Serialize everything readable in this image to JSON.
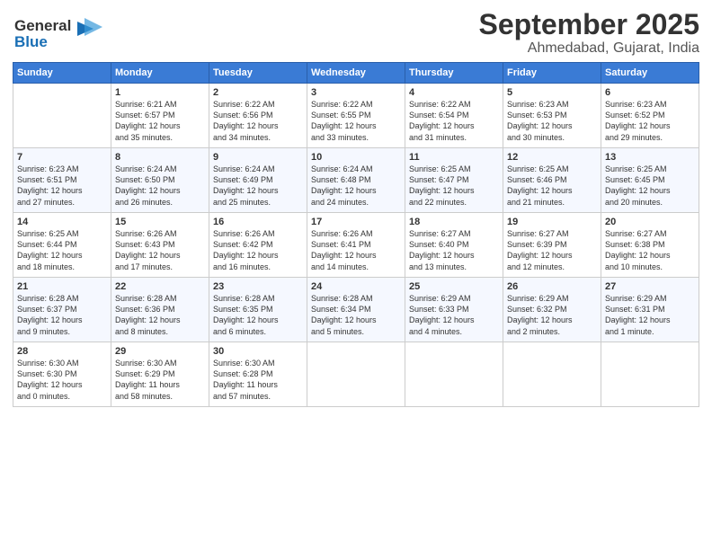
{
  "header": {
    "logo_line1": "General",
    "logo_line2": "Blue",
    "month": "September 2025",
    "location": "Ahmedabad, Gujarat, India"
  },
  "weekdays": [
    "Sunday",
    "Monday",
    "Tuesday",
    "Wednesday",
    "Thursday",
    "Friday",
    "Saturday"
  ],
  "weeks": [
    [
      {
        "day": "",
        "text": ""
      },
      {
        "day": "1",
        "text": "Sunrise: 6:21 AM\nSunset: 6:57 PM\nDaylight: 12 hours\nand 35 minutes."
      },
      {
        "day": "2",
        "text": "Sunrise: 6:22 AM\nSunset: 6:56 PM\nDaylight: 12 hours\nand 34 minutes."
      },
      {
        "day": "3",
        "text": "Sunrise: 6:22 AM\nSunset: 6:55 PM\nDaylight: 12 hours\nand 33 minutes."
      },
      {
        "day": "4",
        "text": "Sunrise: 6:22 AM\nSunset: 6:54 PM\nDaylight: 12 hours\nand 31 minutes."
      },
      {
        "day": "5",
        "text": "Sunrise: 6:23 AM\nSunset: 6:53 PM\nDaylight: 12 hours\nand 30 minutes."
      },
      {
        "day": "6",
        "text": "Sunrise: 6:23 AM\nSunset: 6:52 PM\nDaylight: 12 hours\nand 29 minutes."
      }
    ],
    [
      {
        "day": "7",
        "text": "Sunrise: 6:23 AM\nSunset: 6:51 PM\nDaylight: 12 hours\nand 27 minutes."
      },
      {
        "day": "8",
        "text": "Sunrise: 6:24 AM\nSunset: 6:50 PM\nDaylight: 12 hours\nand 26 minutes."
      },
      {
        "day": "9",
        "text": "Sunrise: 6:24 AM\nSunset: 6:49 PM\nDaylight: 12 hours\nand 25 minutes."
      },
      {
        "day": "10",
        "text": "Sunrise: 6:24 AM\nSunset: 6:48 PM\nDaylight: 12 hours\nand 24 minutes."
      },
      {
        "day": "11",
        "text": "Sunrise: 6:25 AM\nSunset: 6:47 PM\nDaylight: 12 hours\nand 22 minutes."
      },
      {
        "day": "12",
        "text": "Sunrise: 6:25 AM\nSunset: 6:46 PM\nDaylight: 12 hours\nand 21 minutes."
      },
      {
        "day": "13",
        "text": "Sunrise: 6:25 AM\nSunset: 6:45 PM\nDaylight: 12 hours\nand 20 minutes."
      }
    ],
    [
      {
        "day": "14",
        "text": "Sunrise: 6:25 AM\nSunset: 6:44 PM\nDaylight: 12 hours\nand 18 minutes."
      },
      {
        "day": "15",
        "text": "Sunrise: 6:26 AM\nSunset: 6:43 PM\nDaylight: 12 hours\nand 17 minutes."
      },
      {
        "day": "16",
        "text": "Sunrise: 6:26 AM\nSunset: 6:42 PM\nDaylight: 12 hours\nand 16 minutes."
      },
      {
        "day": "17",
        "text": "Sunrise: 6:26 AM\nSunset: 6:41 PM\nDaylight: 12 hours\nand 14 minutes."
      },
      {
        "day": "18",
        "text": "Sunrise: 6:27 AM\nSunset: 6:40 PM\nDaylight: 12 hours\nand 13 minutes."
      },
      {
        "day": "19",
        "text": "Sunrise: 6:27 AM\nSunset: 6:39 PM\nDaylight: 12 hours\nand 12 minutes."
      },
      {
        "day": "20",
        "text": "Sunrise: 6:27 AM\nSunset: 6:38 PM\nDaylight: 12 hours\nand 10 minutes."
      }
    ],
    [
      {
        "day": "21",
        "text": "Sunrise: 6:28 AM\nSunset: 6:37 PM\nDaylight: 12 hours\nand 9 minutes."
      },
      {
        "day": "22",
        "text": "Sunrise: 6:28 AM\nSunset: 6:36 PM\nDaylight: 12 hours\nand 8 minutes."
      },
      {
        "day": "23",
        "text": "Sunrise: 6:28 AM\nSunset: 6:35 PM\nDaylight: 12 hours\nand 6 minutes."
      },
      {
        "day": "24",
        "text": "Sunrise: 6:28 AM\nSunset: 6:34 PM\nDaylight: 12 hours\nand 5 minutes."
      },
      {
        "day": "25",
        "text": "Sunrise: 6:29 AM\nSunset: 6:33 PM\nDaylight: 12 hours\nand 4 minutes."
      },
      {
        "day": "26",
        "text": "Sunrise: 6:29 AM\nSunset: 6:32 PM\nDaylight: 12 hours\nand 2 minutes."
      },
      {
        "day": "27",
        "text": "Sunrise: 6:29 AM\nSunset: 6:31 PM\nDaylight: 12 hours\nand 1 minute."
      }
    ],
    [
      {
        "day": "28",
        "text": "Sunrise: 6:30 AM\nSunset: 6:30 PM\nDaylight: 12 hours\nand 0 minutes."
      },
      {
        "day": "29",
        "text": "Sunrise: 6:30 AM\nSunset: 6:29 PM\nDaylight: 11 hours\nand 58 minutes."
      },
      {
        "day": "30",
        "text": "Sunrise: 6:30 AM\nSunset: 6:28 PM\nDaylight: 11 hours\nand 57 minutes."
      },
      {
        "day": "",
        "text": ""
      },
      {
        "day": "",
        "text": ""
      },
      {
        "day": "",
        "text": ""
      },
      {
        "day": "",
        "text": ""
      }
    ]
  ]
}
